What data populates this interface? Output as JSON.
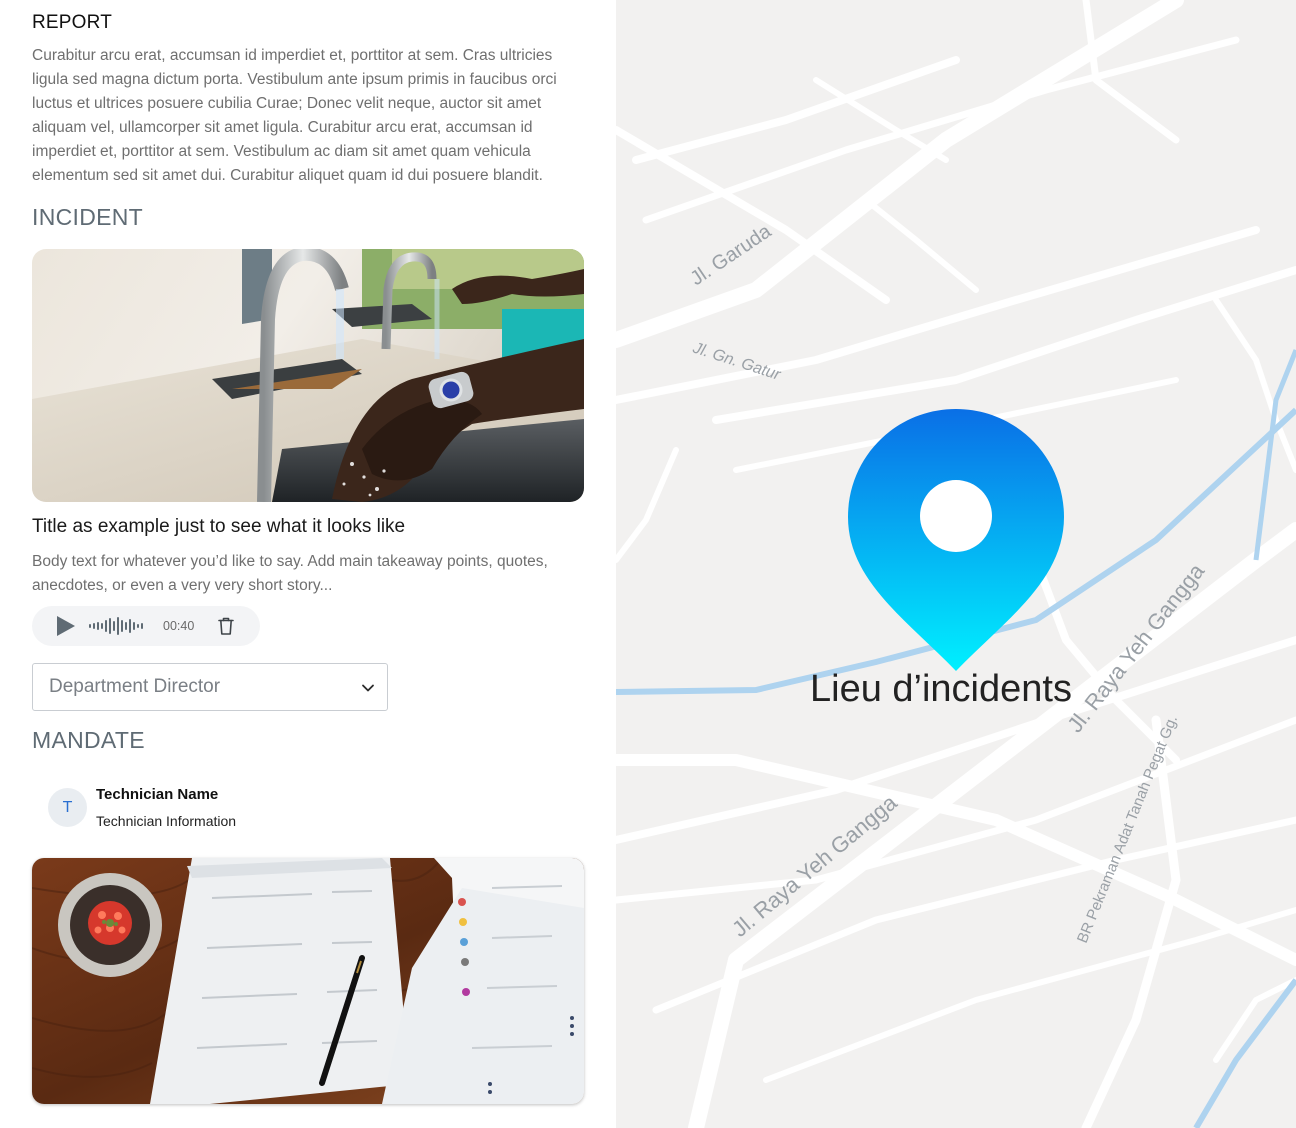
{
  "report": {
    "title": "REPORT",
    "body": "Curabitur arcu erat, accumsan id imperdiet et, porttitor at sem. Cras ultricies ligula sed magna dictum porta. Vestibulum ante ipsum primis in faucibus orci luctus et ultrices posuere cubilia Curae; Donec velit neque, auctor sit amet aliquam vel, ullamcorper sit amet ligula. Curabitur arcu erat, accumsan id imperdiet et, porttitor at sem. Vestibulum ac diam sit amet quam vehicula elementum sed sit amet dui. Curabitur aliquet quam id dui posuere blandit."
  },
  "incident": {
    "section_title": "INCIDENT",
    "card_title": "Title as example just to see what it looks like",
    "card_body": "Body text for whatever you’d like to say. Add main takeaway points, quotes, anecdotes, or even a very very short story...",
    "audio": {
      "duration": "00:40",
      "play_icon": "play-icon",
      "delete_icon": "trash-icon"
    },
    "assignee_select": {
      "value": "Department Director",
      "icon": "chevron-down-icon"
    }
  },
  "mandate": {
    "section_title": "MANDATE",
    "technician": {
      "initial": "T",
      "name": "Technician Name",
      "info": "Technician Information"
    }
  },
  "map": {
    "pin_label": "Lieu d’incidents",
    "pin_gradient": [
      "#0a6fe6",
      "#00f0ff"
    ],
    "streets": [
      "Jl. Garuda",
      "Jl. Gn. Gatur",
      "Jl. Raya Yeh Gangga",
      "Jl. Raya Yeh Gangga",
      "BR Pekraman Adat Tanah Pegat Gg."
    ]
  }
}
